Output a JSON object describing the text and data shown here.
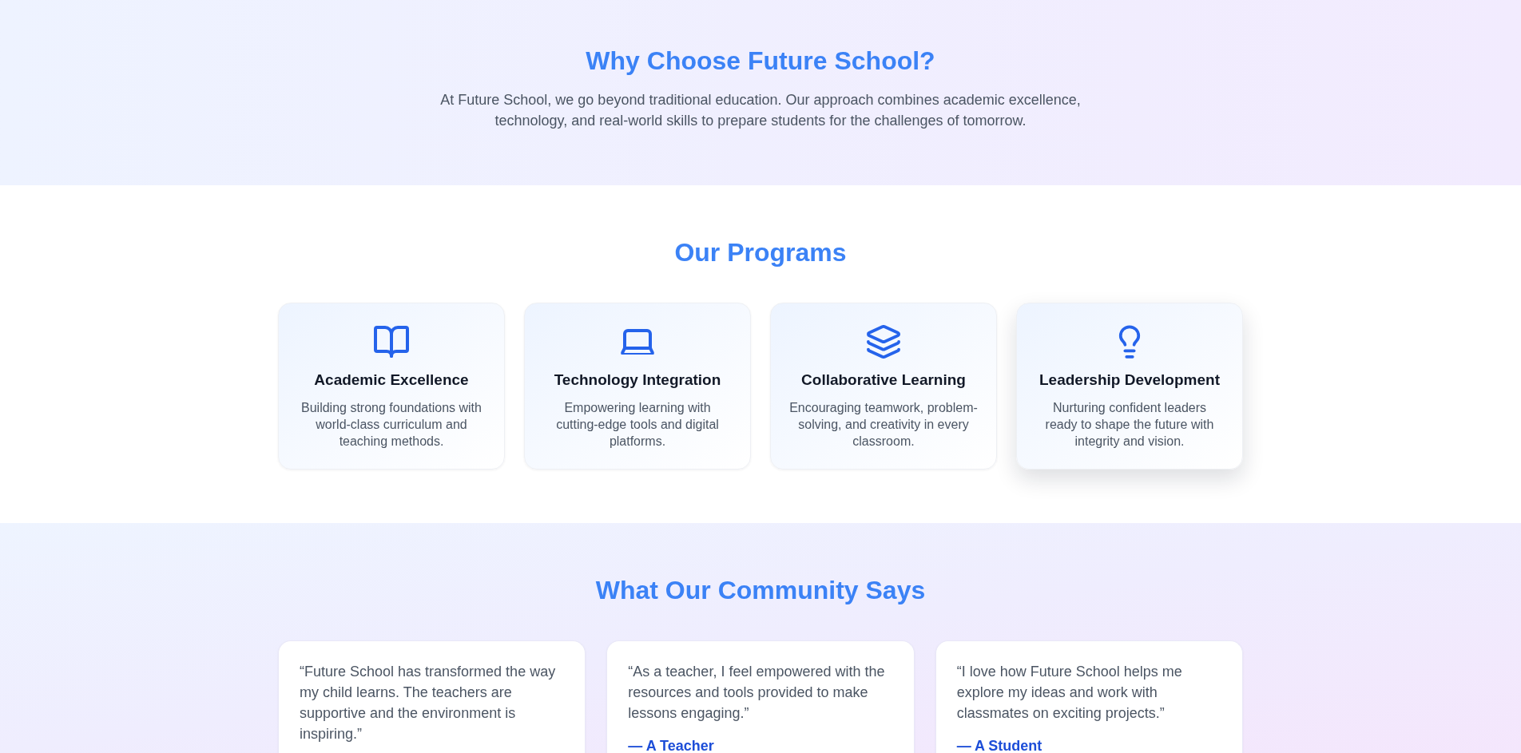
{
  "hero": {
    "title": "Why Choose Future School?",
    "text": "At Future School, we go beyond traditional education. Our approach combines academic excellence, technology, and real-world skills to prepare students for the challenges of tomorrow."
  },
  "programs": {
    "title": "Our Programs",
    "cards": [
      {
        "title": "Academic Excellence",
        "text": "Building strong foundations with world-class curriculum and teaching methods.",
        "hovered": false
      },
      {
        "title": "Technology Integration",
        "text": "Empowering learning with cutting-edge tools and digital platforms.",
        "hovered": false
      },
      {
        "title": "Collaborative Learning",
        "text": "Encouraging teamwork, problem-solving, and creativity in every classroom.",
        "hovered": false
      },
      {
        "title": "Leadership Development",
        "text": "Nurturing confident leaders ready to shape the future with integrity and vision.",
        "hovered": true
      }
    ]
  },
  "testimonials": {
    "title": "What Our Community Says",
    "cards": [
      {
        "quote": "“Future School has transformed the way my child learns. The teachers are supportive and the environment is inspiring.”"
      },
      {
        "quote": "“As a teacher, I feel empowered with the resources and tools provided to make lessons engaging.”",
        "author": "— A Teacher"
      },
      {
        "quote": "“I love how Future School helps me explore my ideas and work with classmates on exciting projects.”",
        "author": "— A Student"
      }
    ]
  }
}
